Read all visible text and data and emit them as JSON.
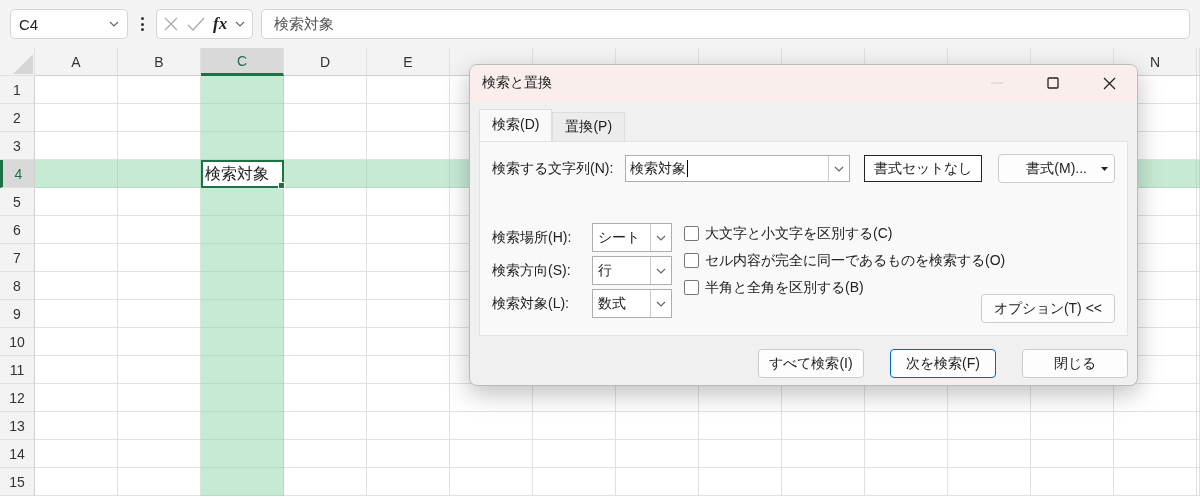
{
  "name_box": {
    "value": "C4"
  },
  "formula_bar": {
    "function_label": "fx",
    "value": "検索対象"
  },
  "sheet": {
    "columns": [
      {
        "label": "A",
        "selected": false
      },
      {
        "label": "B",
        "selected": false
      },
      {
        "label": "C",
        "selected": true
      },
      {
        "label": "D",
        "selected": false
      },
      {
        "label": "E",
        "selected": false
      },
      {
        "selected": false
      },
      {
        "selected": false
      },
      {
        "selected": false
      },
      {
        "selected": false
      },
      {
        "selected": false
      },
      {
        "selected": false
      },
      {
        "selected": false
      },
      {
        "selected": false
      },
      {
        "label": "N",
        "selected": false
      }
    ],
    "rows": [
      {
        "label": "1",
        "selected": false
      },
      {
        "label": "2",
        "selected": false
      },
      {
        "label": "3",
        "selected": false
      },
      {
        "label": "4",
        "selected": true,
        "active_cell": {
          "value": "検索対象"
        }
      },
      {
        "label": "5",
        "selected": false
      },
      {
        "label": "6",
        "selected": false
      },
      {
        "label": "7",
        "selected": false
      },
      {
        "label": "8",
        "selected": false
      },
      {
        "label": "9",
        "selected": false
      },
      {
        "label": "10",
        "selected": false
      },
      {
        "label": "11",
        "selected": false
      },
      {
        "label": "12",
        "selected": false
      },
      {
        "label": "13",
        "selected": false
      },
      {
        "label": "14",
        "selected": false
      },
      {
        "label": "15",
        "selected": false
      }
    ]
  },
  "dialog": {
    "title": "検索と置換",
    "tabs": [
      {
        "label": "検索(D)",
        "selected": true
      },
      {
        "label": "置換(P)",
        "selected": false
      }
    ],
    "find_what": {
      "label": "検索する文字列(N):",
      "value": "検索対象"
    },
    "format_preview": "書式セットなし",
    "format_button": {
      "label": "書式(M)..."
    },
    "dropdowns": [
      {
        "label": "検索場所(H):",
        "value": "シート"
      },
      {
        "label": "検索方向(S):",
        "value": "行"
      },
      {
        "label": "検索対象(L):",
        "value": "数式"
      }
    ],
    "checkboxes": [
      {
        "label": "大文字と小文字を区別する(C)",
        "checked": false
      },
      {
        "label": "セル内容が完全に同一であるものを検索する(O)",
        "checked": false
      },
      {
        "label": "半角と全角を区別する(B)",
        "checked": false
      }
    ],
    "options_button": {
      "label": "オプション(T) <<"
    },
    "buttons": [
      {
        "label": "すべて検索(I)",
        "default": false
      },
      {
        "label": "次を検索(F)",
        "default": true
      },
      {
        "label": "閉じる",
        "default": false
      }
    ]
  }
}
